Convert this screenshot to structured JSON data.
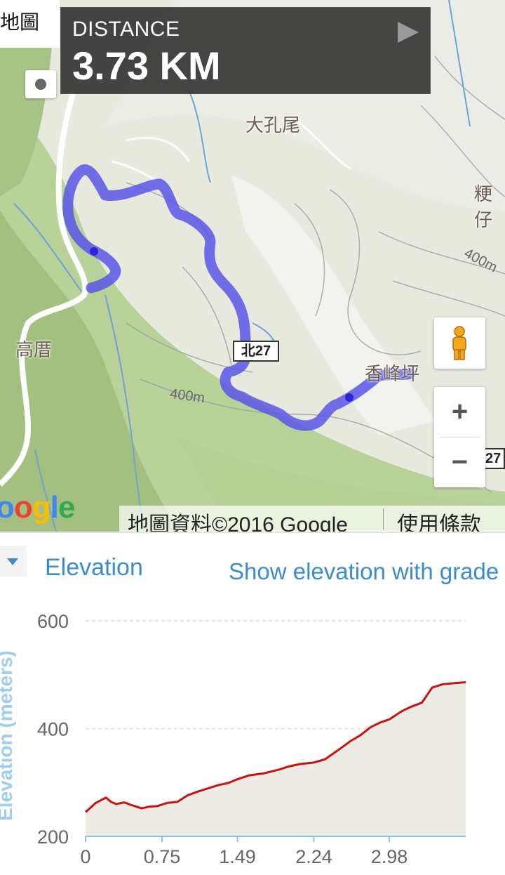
{
  "map": {
    "tab_label": "地圖",
    "distance_label": "DISTANCE",
    "distance_value": "3.73 KM",
    "places": [
      "大孔尾",
      "高厝",
      "香峰坪",
      "粳仔"
    ],
    "contour_labels": [
      "400m",
      "400m"
    ],
    "road_shield": "北27",
    "road_shield_partial": "27",
    "google_logo": "oogle",
    "attribution": "地圖資料©2016 Google",
    "terms": "使用條款",
    "zoom_in": "+",
    "zoom_out": "−",
    "route_color": "#5b55e8"
  },
  "elevation": {
    "title": "Elevation",
    "show_grade": "Show elevation with grade",
    "colors": {
      "line": "#cc1111",
      "fill": "#ecebe5",
      "accent": "#3a8ccf"
    }
  },
  "chart_data": {
    "type": "area",
    "title": "",
    "xlabel": "",
    "ylabel": "Elevation (meters)",
    "ylim": [
      200,
      600
    ],
    "yticks": [
      "600",
      "400",
      "200"
    ],
    "xticks": [
      "0",
      "0.75",
      "1.49",
      "2.24",
      "2.98"
    ],
    "xlim": [
      0,
      3.73
    ],
    "grid": true,
    "series": [
      {
        "values": [
          [
            0,
            245
          ],
          [
            0.1,
            262
          ],
          [
            0.2,
            272
          ],
          [
            0.25,
            264
          ],
          [
            0.3,
            260
          ],
          [
            0.38,
            263
          ],
          [
            0.45,
            258
          ],
          [
            0.55,
            252
          ],
          [
            0.62,
            255
          ],
          [
            0.7,
            256
          ],
          [
            0.8,
            262
          ],
          [
            0.9,
            264
          ],
          [
            1.0,
            276
          ],
          [
            1.1,
            283
          ],
          [
            1.2,
            289
          ],
          [
            1.3,
            295
          ],
          [
            1.4,
            299
          ],
          [
            1.49,
            306
          ],
          [
            1.6,
            313
          ],
          [
            1.75,
            317
          ],
          [
            1.9,
            324
          ],
          [
            2.0,
            330
          ],
          [
            2.1,
            334
          ],
          [
            2.24,
            337
          ],
          [
            2.35,
            343
          ],
          [
            2.5,
            363
          ],
          [
            2.6,
            377
          ],
          [
            2.7,
            388
          ],
          [
            2.8,
            403
          ],
          [
            2.9,
            412
          ],
          [
            2.98,
            417
          ],
          [
            3.1,
            432
          ],
          [
            3.2,
            441
          ],
          [
            3.3,
            448
          ],
          [
            3.4,
            476
          ],
          [
            3.5,
            482
          ],
          [
            3.6,
            484
          ],
          [
            3.73,
            486
          ]
        ]
      }
    ]
  }
}
